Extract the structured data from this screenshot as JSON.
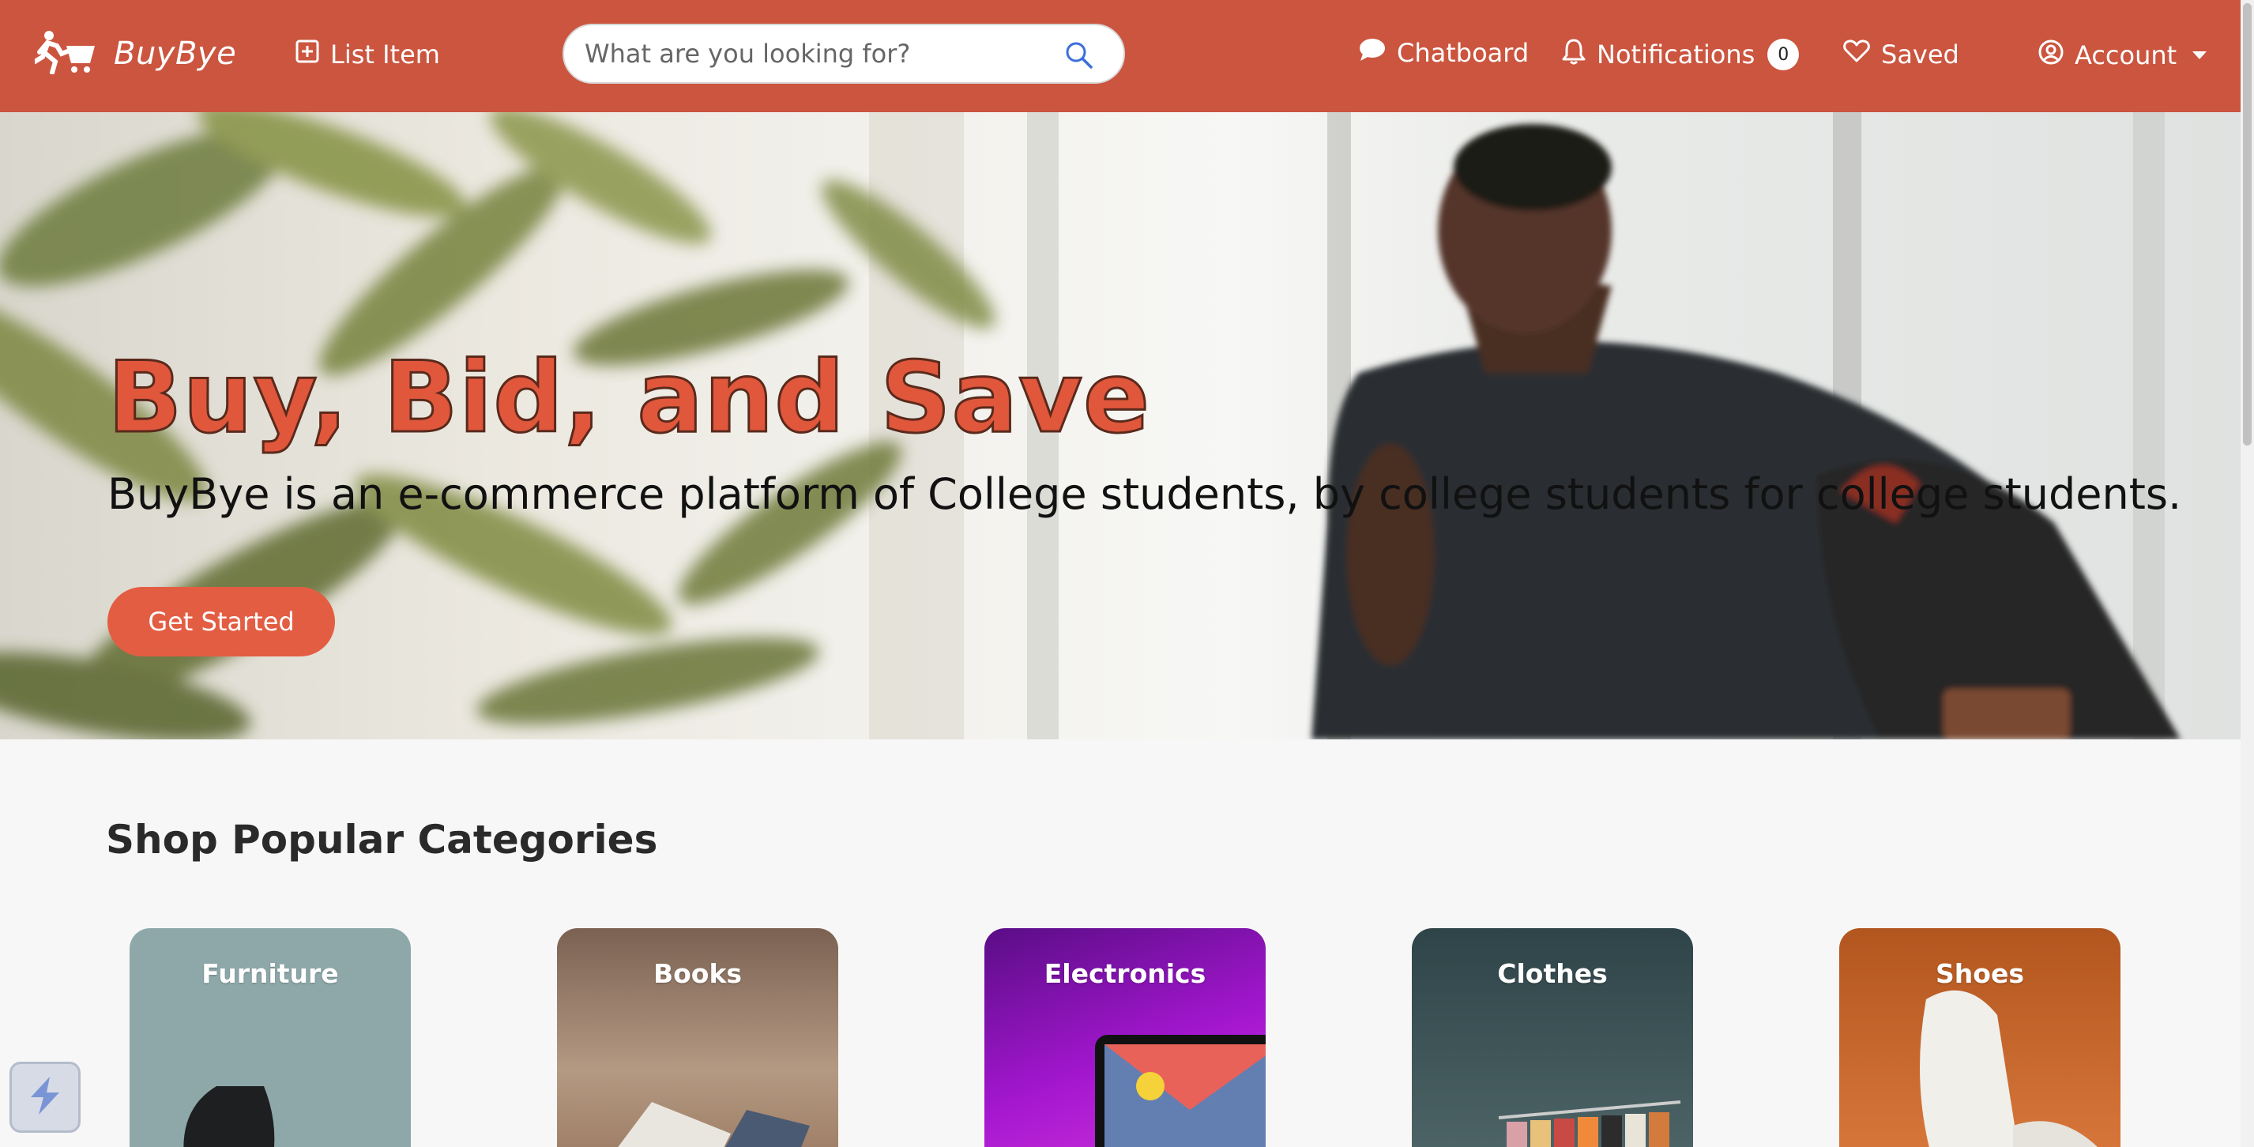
{
  "brand": {
    "name": "BuyBye",
    "logo_icon": "runner-cart-icon"
  },
  "nav": {
    "list_item": "List Item",
    "chatboard": "Chatboard",
    "notifications": "Notifications",
    "notifications_count": "0",
    "saved": "Saved",
    "account": "Account"
  },
  "search": {
    "placeholder": "What are you looking for?",
    "value": ""
  },
  "hero": {
    "title": "Buy, Bid, and Save",
    "subtitle": "BuyBye is an e-commerce platform of College students, by college students for college students.",
    "cta_label": "Get Started"
  },
  "categories": {
    "title": "Shop Popular Categories",
    "items": [
      {
        "label": "Furniture",
        "color": "#8ea8aa"
      },
      {
        "label": "Books",
        "color": "#9c7a62"
      },
      {
        "label": "Electronics",
        "color": "#a517d0"
      },
      {
        "label": "Clothes",
        "color": "#3f575a"
      },
      {
        "label": "Shoes",
        "color": "#c7612a"
      }
    ]
  },
  "colors": {
    "accent": "#cb553f",
    "cta": "#e35d43",
    "hero_title": "#e0573c"
  }
}
